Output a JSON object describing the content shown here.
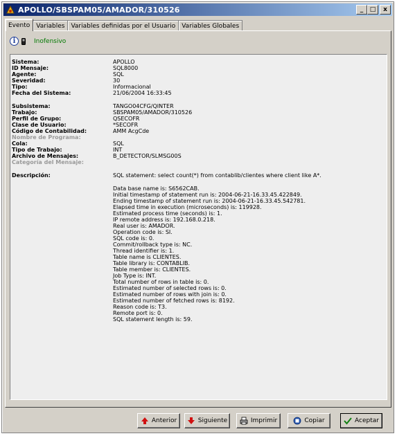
{
  "window": {
    "title": "APOLLO/SBSPAM05/AMADOR/310526"
  },
  "title_buttons": {
    "minimize": "_",
    "maximize": "□",
    "close": "x"
  },
  "tabs": [
    {
      "label": "Evento"
    },
    {
      "label": "Variables"
    },
    {
      "label": "Variables definidas por el Usuario"
    },
    {
      "label": "Variables Globales"
    }
  ],
  "status": {
    "text": "Inofensivo",
    "color": "#007800"
  },
  "fields": {
    "sistema": {
      "label": "Sistema:",
      "value": "APOLLO"
    },
    "id_mensaje": {
      "label": "ID Mensaje:",
      "value": "SQL8000"
    },
    "agente": {
      "label": "Agente:",
      "value": "SQL"
    },
    "severidad": {
      "label": "Severidad:",
      "value": "30"
    },
    "tipo": {
      "label": "Tipo:",
      "value": "Informacional"
    },
    "fecha": {
      "label": "Fecha del Sistema:",
      "value": "21/06/2004 16:33:45"
    },
    "subsistema": {
      "label": "Subsistema:",
      "value": "TANGO04CFG/QINTER"
    },
    "trabajo": {
      "label": "Trabajo:",
      "value": "SBSPAM05/AMADOR/310526"
    },
    "perfil": {
      "label": "Perfil de Grupo:",
      "value": "QSECOFR"
    },
    "clase": {
      "label": "Clase de Usuario:",
      "value": "*SECOFR"
    },
    "contabilidad": {
      "label": "Código de Contabilidad:",
      "value": "AMM AcgCde"
    },
    "programa": {
      "label": "Nombre de Programa:",
      "value": ""
    },
    "cola": {
      "label": "Cola:",
      "value": "SQL"
    },
    "tipo_trabajo": {
      "label": "Tipo de Trabajo:",
      "value": "INT"
    },
    "archivo": {
      "label": "Archivo de Mensajes:",
      "value": "B_DETECTOR/SLMSG00S"
    },
    "categoria": {
      "label": "Categoría del Mensaje:",
      "value": ""
    },
    "descripcion": {
      "label": "Descripción:",
      "value": "SQL statement: select count(*) from contablib/clientes where client like A*."
    }
  },
  "details": [
    "Data base name is: S6562CAB.",
    "Initial timestamp of statement run is: 2004-06-21-16.33.45.422849.",
    "Ending timestamp of statement run is: 2004-06-21-16.33.45.542781.",
    "Elapsed time in execution (microseconds) is: 119928.",
    "Estimated process time (seconds) is: 1.",
    "IP remote address is: 192.168.0.218.",
    "Real user is: AMADOR.",
    "Operation code is: SI.",
    "SQL code is: 0.",
    "Commit/rollback type is: NC.",
    "Thread identifier is: 1.",
    "Table name is CLIENTES.",
    "Table library is: CONTABLIB.",
    "Table member is: CLIENTES.",
    "Job Type is: INT.",
    "Total number of rows in table is: 0.",
    "Estimated number of selected rows is: 0.",
    "Estimated number of rows with join is: 0.",
    "Estimated number of fetched rows is: 8192.",
    "Reason code is: T3.",
    "Remote port is: 0.",
    "SQL statement length is: 59."
  ],
  "buttons": {
    "anterior": "Anterior",
    "siguiente": "Siguiente",
    "imprimir": "Imprimir",
    "copiar": "Copiar",
    "aceptar": "Aceptar"
  }
}
